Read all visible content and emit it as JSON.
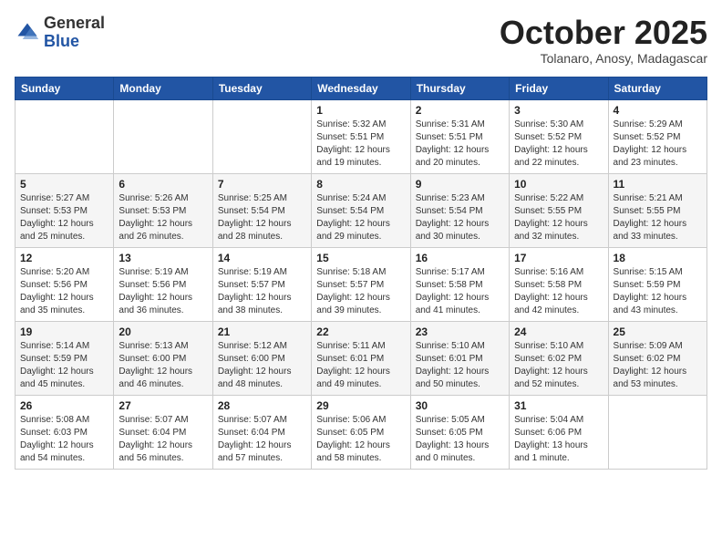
{
  "header": {
    "logo_general": "General",
    "logo_blue": "Blue",
    "month": "October 2025",
    "location": "Tolanaro, Anosy, Madagascar"
  },
  "weekdays": [
    "Sunday",
    "Monday",
    "Tuesday",
    "Wednesday",
    "Thursday",
    "Friday",
    "Saturday"
  ],
  "weeks": [
    [
      {
        "day": "",
        "info": ""
      },
      {
        "day": "",
        "info": ""
      },
      {
        "day": "",
        "info": ""
      },
      {
        "day": "1",
        "info": "Sunrise: 5:32 AM\nSunset: 5:51 PM\nDaylight: 12 hours\nand 19 minutes."
      },
      {
        "day": "2",
        "info": "Sunrise: 5:31 AM\nSunset: 5:51 PM\nDaylight: 12 hours\nand 20 minutes."
      },
      {
        "day": "3",
        "info": "Sunrise: 5:30 AM\nSunset: 5:52 PM\nDaylight: 12 hours\nand 22 minutes."
      },
      {
        "day": "4",
        "info": "Sunrise: 5:29 AM\nSunset: 5:52 PM\nDaylight: 12 hours\nand 23 minutes."
      }
    ],
    [
      {
        "day": "5",
        "info": "Sunrise: 5:27 AM\nSunset: 5:53 PM\nDaylight: 12 hours\nand 25 minutes."
      },
      {
        "day": "6",
        "info": "Sunrise: 5:26 AM\nSunset: 5:53 PM\nDaylight: 12 hours\nand 26 minutes."
      },
      {
        "day": "7",
        "info": "Sunrise: 5:25 AM\nSunset: 5:54 PM\nDaylight: 12 hours\nand 28 minutes."
      },
      {
        "day": "8",
        "info": "Sunrise: 5:24 AM\nSunset: 5:54 PM\nDaylight: 12 hours\nand 29 minutes."
      },
      {
        "day": "9",
        "info": "Sunrise: 5:23 AM\nSunset: 5:54 PM\nDaylight: 12 hours\nand 30 minutes."
      },
      {
        "day": "10",
        "info": "Sunrise: 5:22 AM\nSunset: 5:55 PM\nDaylight: 12 hours\nand 32 minutes."
      },
      {
        "day": "11",
        "info": "Sunrise: 5:21 AM\nSunset: 5:55 PM\nDaylight: 12 hours\nand 33 minutes."
      }
    ],
    [
      {
        "day": "12",
        "info": "Sunrise: 5:20 AM\nSunset: 5:56 PM\nDaylight: 12 hours\nand 35 minutes."
      },
      {
        "day": "13",
        "info": "Sunrise: 5:19 AM\nSunset: 5:56 PM\nDaylight: 12 hours\nand 36 minutes."
      },
      {
        "day": "14",
        "info": "Sunrise: 5:19 AM\nSunset: 5:57 PM\nDaylight: 12 hours\nand 38 minutes."
      },
      {
        "day": "15",
        "info": "Sunrise: 5:18 AM\nSunset: 5:57 PM\nDaylight: 12 hours\nand 39 minutes."
      },
      {
        "day": "16",
        "info": "Sunrise: 5:17 AM\nSunset: 5:58 PM\nDaylight: 12 hours\nand 41 minutes."
      },
      {
        "day": "17",
        "info": "Sunrise: 5:16 AM\nSunset: 5:58 PM\nDaylight: 12 hours\nand 42 minutes."
      },
      {
        "day": "18",
        "info": "Sunrise: 5:15 AM\nSunset: 5:59 PM\nDaylight: 12 hours\nand 43 minutes."
      }
    ],
    [
      {
        "day": "19",
        "info": "Sunrise: 5:14 AM\nSunset: 5:59 PM\nDaylight: 12 hours\nand 45 minutes."
      },
      {
        "day": "20",
        "info": "Sunrise: 5:13 AM\nSunset: 6:00 PM\nDaylight: 12 hours\nand 46 minutes."
      },
      {
        "day": "21",
        "info": "Sunrise: 5:12 AM\nSunset: 6:00 PM\nDaylight: 12 hours\nand 48 minutes."
      },
      {
        "day": "22",
        "info": "Sunrise: 5:11 AM\nSunset: 6:01 PM\nDaylight: 12 hours\nand 49 minutes."
      },
      {
        "day": "23",
        "info": "Sunrise: 5:10 AM\nSunset: 6:01 PM\nDaylight: 12 hours\nand 50 minutes."
      },
      {
        "day": "24",
        "info": "Sunrise: 5:10 AM\nSunset: 6:02 PM\nDaylight: 12 hours\nand 52 minutes."
      },
      {
        "day": "25",
        "info": "Sunrise: 5:09 AM\nSunset: 6:02 PM\nDaylight: 12 hours\nand 53 minutes."
      }
    ],
    [
      {
        "day": "26",
        "info": "Sunrise: 5:08 AM\nSunset: 6:03 PM\nDaylight: 12 hours\nand 54 minutes."
      },
      {
        "day": "27",
        "info": "Sunrise: 5:07 AM\nSunset: 6:04 PM\nDaylight: 12 hours\nand 56 minutes."
      },
      {
        "day": "28",
        "info": "Sunrise: 5:07 AM\nSunset: 6:04 PM\nDaylight: 12 hours\nand 57 minutes."
      },
      {
        "day": "29",
        "info": "Sunrise: 5:06 AM\nSunset: 6:05 PM\nDaylight: 12 hours\nand 58 minutes."
      },
      {
        "day": "30",
        "info": "Sunrise: 5:05 AM\nSunset: 6:05 PM\nDaylight: 13 hours\nand 0 minutes."
      },
      {
        "day": "31",
        "info": "Sunrise: 5:04 AM\nSunset: 6:06 PM\nDaylight: 13 hours\nand 1 minute."
      },
      {
        "day": "",
        "info": ""
      }
    ]
  ]
}
